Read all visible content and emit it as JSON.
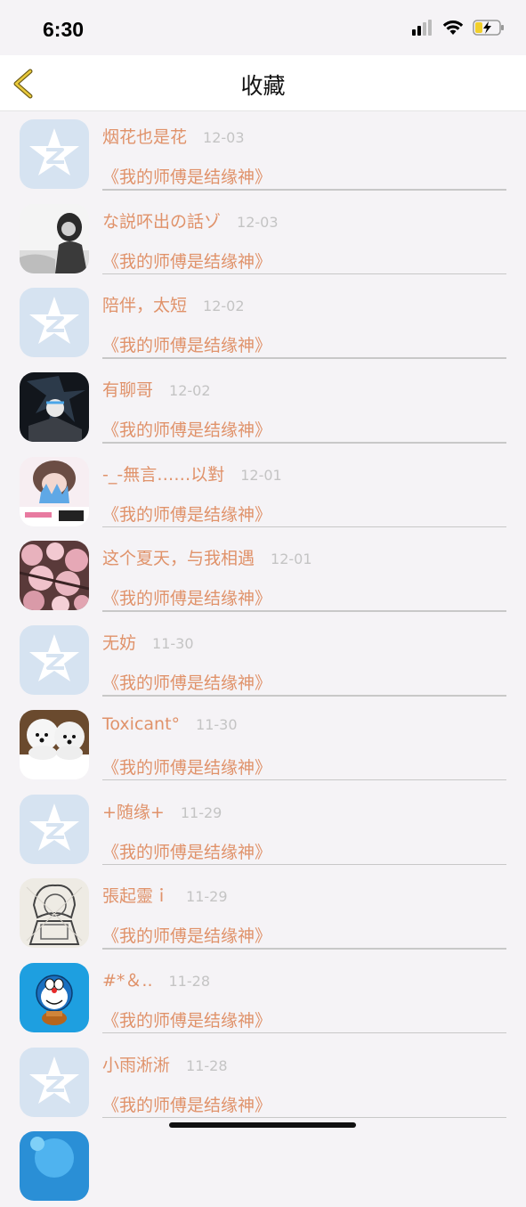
{
  "status_bar": {
    "time": "6:30"
  },
  "nav": {
    "title": "收藏"
  },
  "rows": [
    {
      "name": "烟花也是花",
      "date": "12-03",
      "book": "《我的师傅是结缘神》",
      "avatar": "qq-star"
    },
    {
      "name": "な説吥出の話ゾ",
      "date": "12-03",
      "book": "《我的师傅是结缘神》",
      "avatar": "girl-photo"
    },
    {
      "name": "陪伴，太短",
      "date": "12-02",
      "book": "《我的师傅是结缘神》",
      "avatar": "qq-star"
    },
    {
      "name": "有聊哥",
      "date": "12-02",
      "book": "《我的师傅是结缘神》",
      "avatar": "anime-dark"
    },
    {
      "name": "-_-無言……以對",
      "date": "12-01",
      "book": "《我的师傅是结缘神》",
      "avatar": "flower-girl"
    },
    {
      "name": "这个夏天，与我相遇",
      "date": "12-01",
      "book": "《我的师傅是结缘神》",
      "avatar": "cherry-blossom"
    },
    {
      "name": "无妨",
      "date": "11-30",
      "book": "《我的师傅是结缘神》",
      "avatar": "qq-star"
    },
    {
      "name": "Toxicant°",
      "date": "11-30",
      "book": "《我的师傅是结缘神》",
      "avatar": "white-dogs"
    },
    {
      "name": "+随缘+",
      "date": "11-29",
      "book": "《我的师傅是结缘神》",
      "avatar": "qq-star"
    },
    {
      "name": "張起靈ｉ",
      "date": "11-29",
      "book": "《我的师傅是结缘神》",
      "avatar": "sketch-girl"
    },
    {
      "name": "#*＆..",
      "date": "11-28",
      "book": "《我的师傅是结缘神》",
      "avatar": "doraemon"
    },
    {
      "name": "小雨淅淅",
      "date": "11-28",
      "book": "《我的师傅是结缘神》",
      "avatar": "qq-star"
    },
    {
      "name": "",
      "date": "",
      "book": "",
      "avatar": "blue-partial"
    }
  ]
}
